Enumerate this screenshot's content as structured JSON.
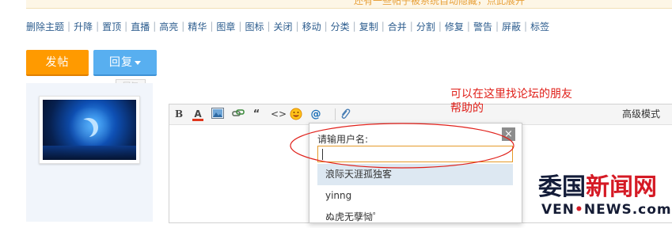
{
  "notice": {
    "text": "还有一些帖子被系统自动隐藏，点此展开"
  },
  "mod_toolbar": {
    "items": [
      "删除主题",
      "升降",
      "置顶",
      "直播",
      "高亮",
      "精华",
      "图章",
      "图标",
      "关闭",
      "移动",
      "分类",
      "复制",
      "合并",
      "分割",
      "修复",
      "警告",
      "屏蔽",
      "标签"
    ],
    "separator": "|"
  },
  "buttons": {
    "post_label": "发帖",
    "reply_label": "回复",
    "reply_tooltip": "回复"
  },
  "editor": {
    "toolbar": {
      "bold": "B",
      "color": "A",
      "quote": "“",
      "code": "<>",
      "at": "@",
      "advanced_mode": "高级模式"
    }
  },
  "annotation": {
    "line1": "可以在这里找论坛的朋友",
    "line2": "帮助的"
  },
  "mention_popup": {
    "label": "请输用户名:",
    "input_value": "",
    "close_symbol": "×",
    "suggestions": [
      "浪际天涯孤独客",
      "yinng",
      "ぬ虎无孽恸゜"
    ]
  },
  "watermark": {
    "title_part1": "委国",
    "title_part2": "新闻网",
    "url": "VEN",
    "url_dots": "•",
    "url_rest": "NEWS",
    "url_end": ".com"
  },
  "colors": {
    "accent_orange": "#ff9a00",
    "accent_blue": "#58aff0",
    "annotation_red": "#e0201a"
  }
}
